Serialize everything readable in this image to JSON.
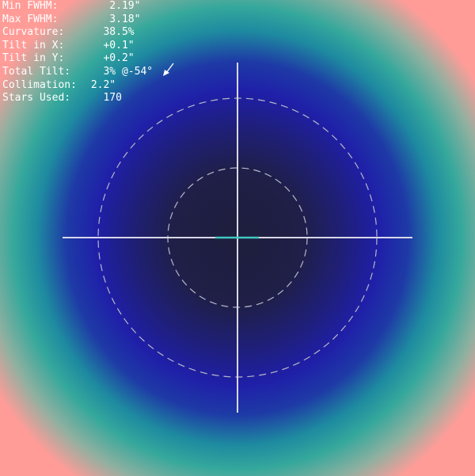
{
  "stats": {
    "min_fwhm": {
      "label": "Min FWHM:",
      "value": "    2.19\""
    },
    "max_fwhm": {
      "label": "Max FWHM:",
      "value": "    3.18\""
    },
    "curvature": {
      "label": "Curvature:",
      "value": "   38.5%"
    },
    "tilt_x": {
      "label": "Tilt in X:",
      "value": "   +0.1\""
    },
    "tilt_y": {
      "label": "Tilt in Y:",
      "value": "   +0.2\""
    },
    "total_tilt": {
      "label": "Total Tilt:",
      "value": "   3% @-54°"
    },
    "collimation": {
      "label": "Collimation:",
      "value": " 2.2\""
    },
    "stars_used": {
      "label": "Stars Used:",
      "value": "   170"
    }
  },
  "tilt_indicator": {
    "icon": "tilt-direction-arrow-icon",
    "angle_deg": -54
  },
  "colors": {
    "center": "#1e1e3c",
    "mid": "#1f1fa8",
    "teal": "#35a89c",
    "edge": "#ff9c98",
    "crosshair": "#d8d8e8",
    "highlight": "#40c8c0"
  }
}
